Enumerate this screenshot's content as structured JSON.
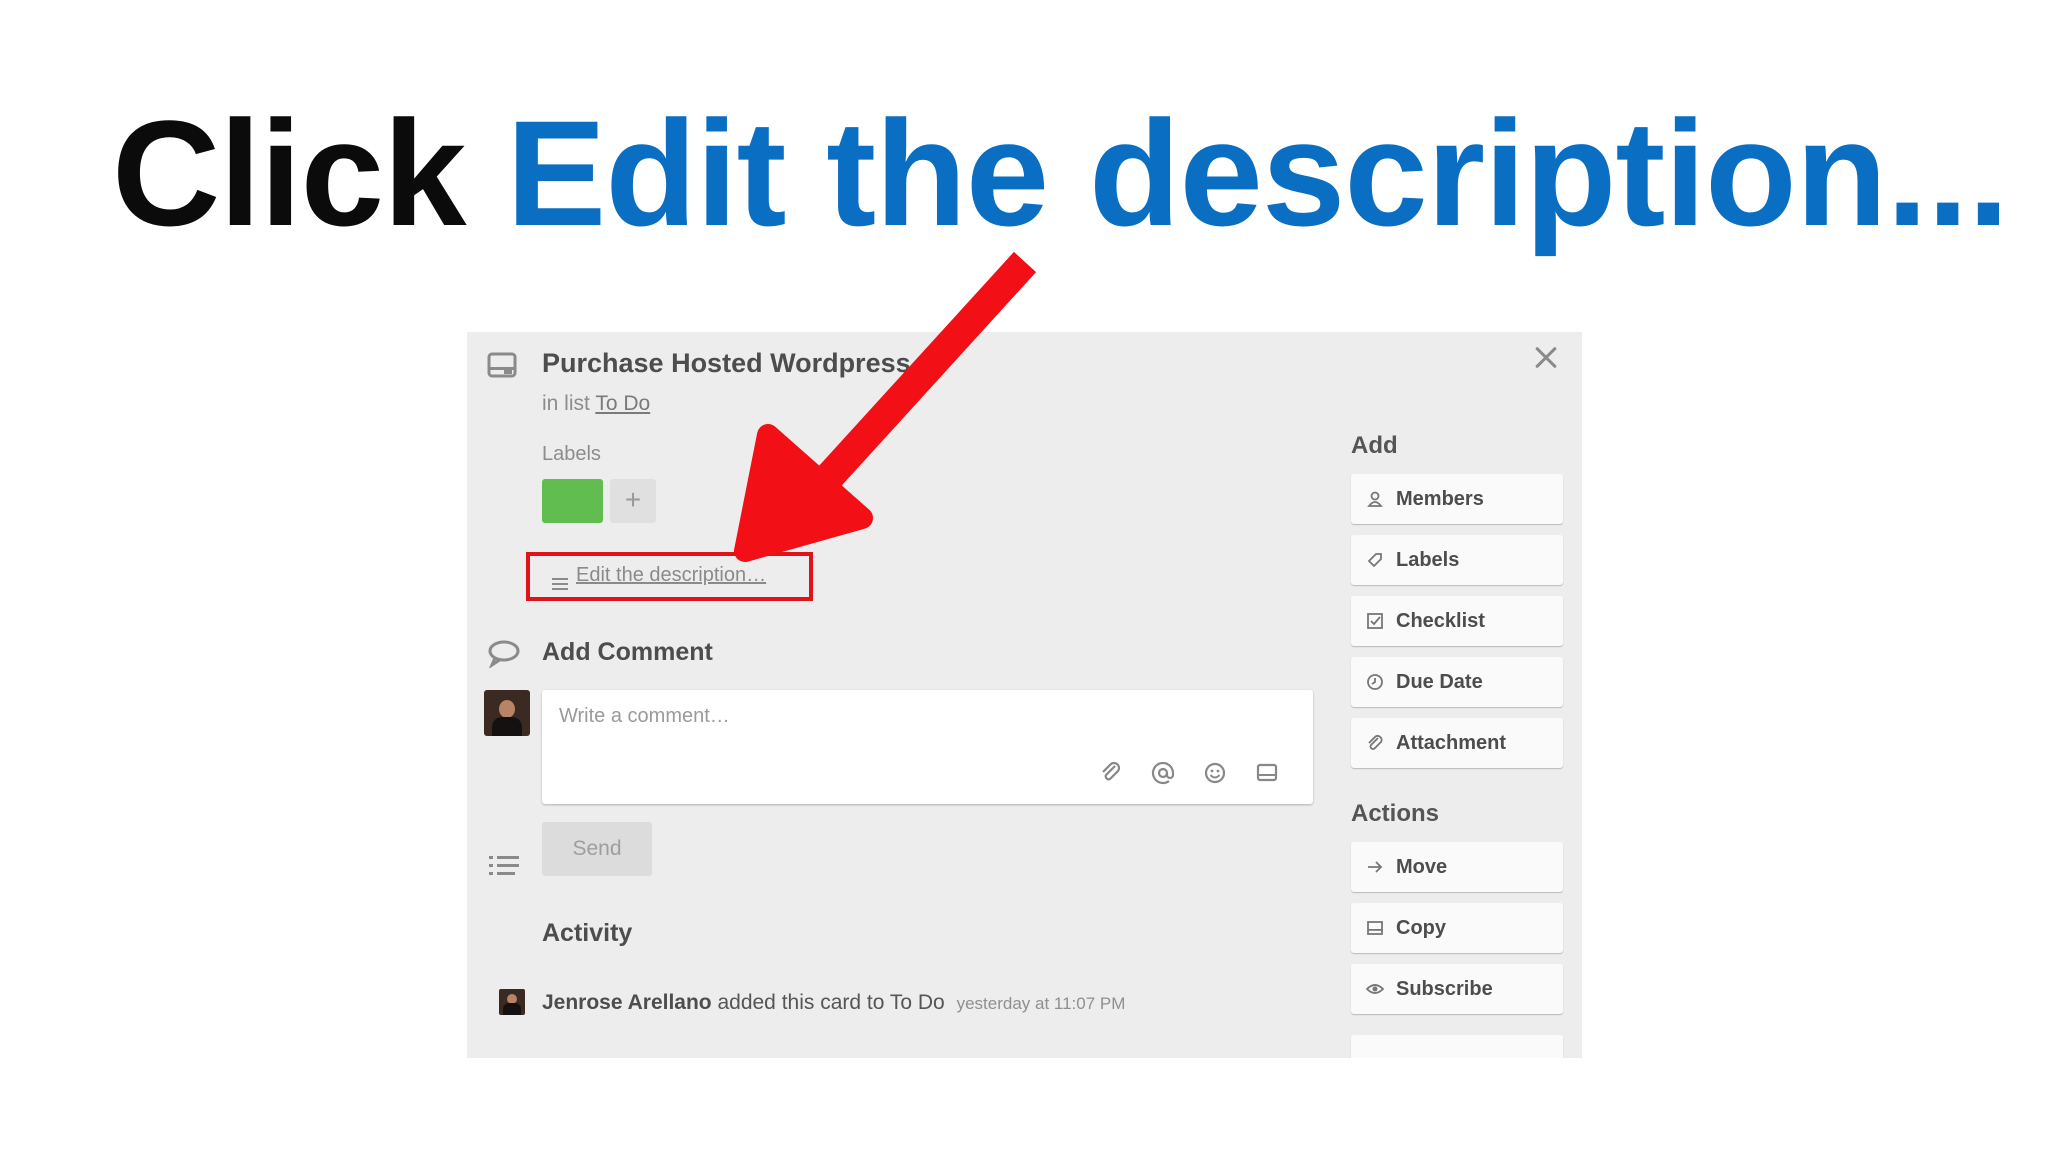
{
  "headline": {
    "prefix": "Click",
    "highlight": "Edit the description..."
  },
  "card": {
    "title": "Purchase Hosted Wordpress",
    "in_list_prefix": "in list",
    "list_name": "To Do",
    "labels_heading": "Labels",
    "add_label": "+",
    "edit_description": "Edit the description…",
    "add_comment_title": "Add Comment",
    "comment_placeholder": "Write a comment…",
    "send_label": "Send",
    "activity_title": "Activity",
    "activity": {
      "user": "Jenrose Arellano",
      "action": "added this card to To Do",
      "time": "yesterday at 11:07 PM"
    }
  },
  "sidebar": {
    "add_heading": "Add",
    "add_items": [
      "Members",
      "Labels",
      "Checklist",
      "Due Date",
      "Attachment"
    ],
    "actions_heading": "Actions",
    "action_items": [
      "Move",
      "Copy",
      "Subscribe"
    ]
  },
  "colors": {
    "highlight_blue": "#0a6fc2",
    "arrow_red": "#f20f16",
    "label_green": "#61bd4f"
  },
  "icons": [
    "card-icon",
    "close-icon",
    "description-lines-icon",
    "comment-bubble-icon",
    "attachment-icon",
    "mention-icon",
    "emoji-icon",
    "card-embed-icon",
    "activity-list-icon",
    "member-icon",
    "label-tag-icon",
    "checklist-icon",
    "clock-icon",
    "paperclip-icon",
    "arrow-right-icon",
    "copy-icon",
    "eye-icon"
  ]
}
